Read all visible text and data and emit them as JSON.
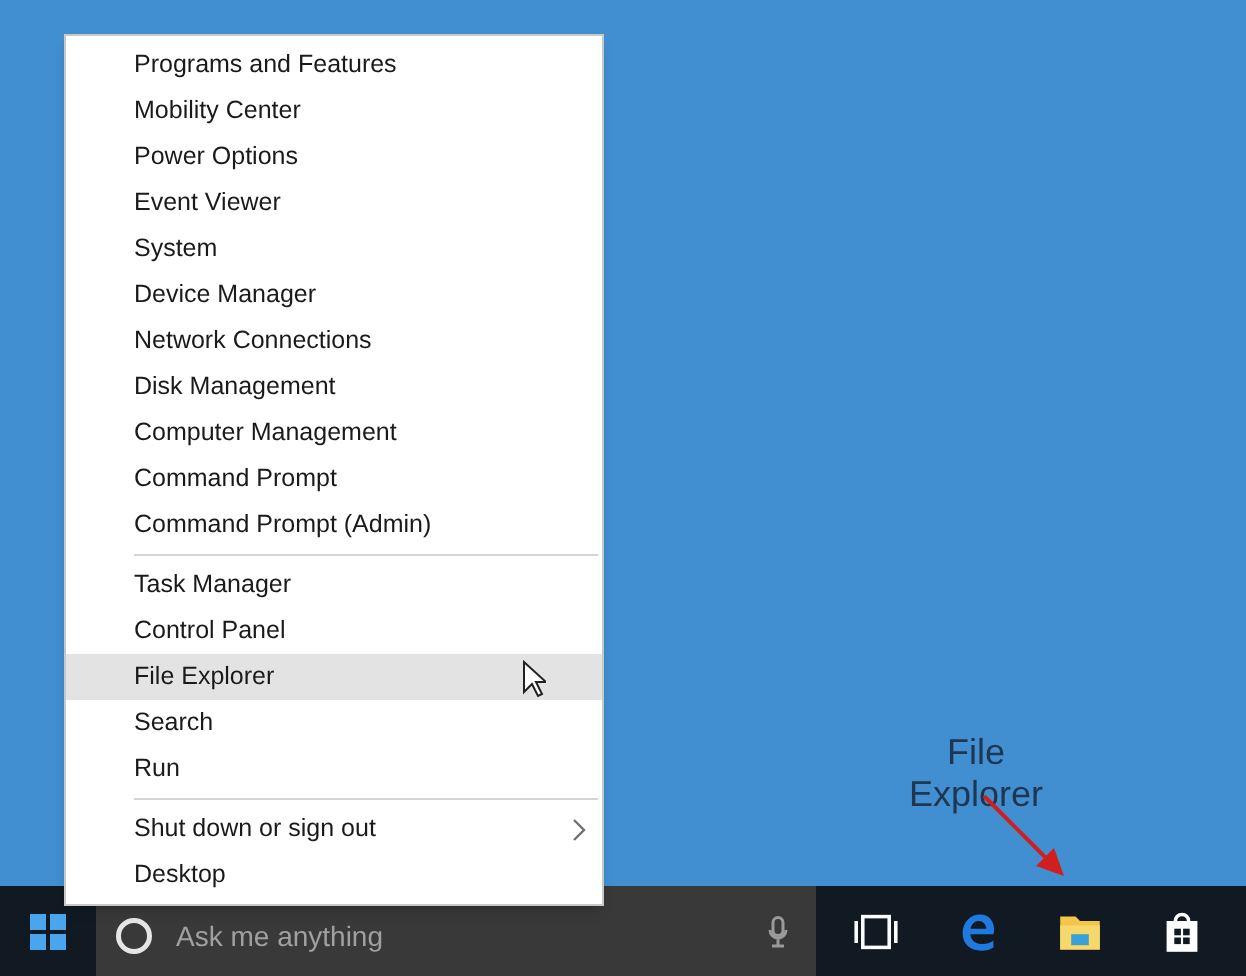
{
  "menu": {
    "groups": [
      [
        {
          "label": "Programs and Features",
          "selected": false,
          "has_submenu": false
        },
        {
          "label": "Mobility Center",
          "selected": false,
          "has_submenu": false
        },
        {
          "label": "Power Options",
          "selected": false,
          "has_submenu": false
        },
        {
          "label": "Event Viewer",
          "selected": false,
          "has_submenu": false
        },
        {
          "label": "System",
          "selected": false,
          "has_submenu": false
        },
        {
          "label": "Device Manager",
          "selected": false,
          "has_submenu": false
        },
        {
          "label": "Network Connections",
          "selected": false,
          "has_submenu": false
        },
        {
          "label": "Disk Management",
          "selected": false,
          "has_submenu": false
        },
        {
          "label": "Computer Management",
          "selected": false,
          "has_submenu": false
        },
        {
          "label": "Command Prompt",
          "selected": false,
          "has_submenu": false
        },
        {
          "label": "Command Prompt (Admin)",
          "selected": false,
          "has_submenu": false
        }
      ],
      [
        {
          "label": "Task Manager",
          "selected": false,
          "has_submenu": false
        },
        {
          "label": "Control Panel",
          "selected": false,
          "has_submenu": false
        },
        {
          "label": "File Explorer",
          "selected": true,
          "has_submenu": false
        },
        {
          "label": "Search",
          "selected": false,
          "has_submenu": false
        },
        {
          "label": "Run",
          "selected": false,
          "has_submenu": false
        }
      ],
      [
        {
          "label": "Shut down or sign out",
          "selected": false,
          "has_submenu": true
        },
        {
          "label": "Desktop",
          "selected": false,
          "has_submenu": false
        }
      ]
    ]
  },
  "annotation": {
    "lines": [
      "File",
      "Explorer"
    ]
  },
  "taskbar": {
    "search": {
      "placeholder": "Ask me anything"
    },
    "apps": [
      {
        "kind": "taskview"
      },
      {
        "kind": "edge"
      },
      {
        "kind": "explorer"
      },
      {
        "kind": "store"
      }
    ]
  }
}
